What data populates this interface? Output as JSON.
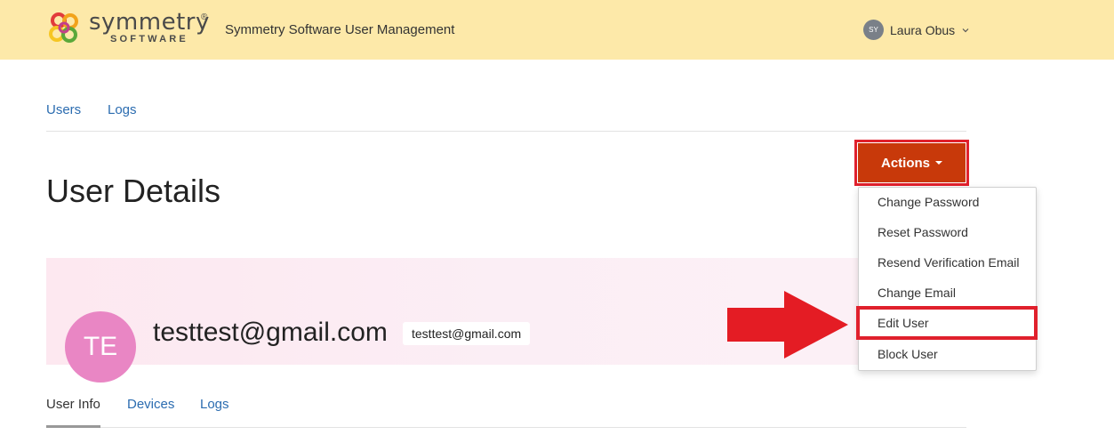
{
  "header": {
    "brand_name": "symmetry",
    "brand_reg": "®",
    "brand_sub": "SOFTWARE",
    "app_title": "Symmetry Software User Management",
    "user_initials": "SY",
    "user_name": "Laura Obus"
  },
  "nav": {
    "users": "Users",
    "logs": "Logs"
  },
  "page_title": "User Details",
  "actions": {
    "label": "Actions",
    "menu": [
      "Change Password",
      "Reset Password",
      "Resend Verification Email",
      "Change Email",
      "Edit User",
      "Block User"
    ],
    "highlighted_item": "Edit User"
  },
  "profile": {
    "initials": "TE",
    "display_name": "testtest@gmail.com",
    "email_chip": "testtest@gmail.com"
  },
  "tabs": {
    "user_info": "User Info",
    "devices": "Devices",
    "logs": "Logs",
    "active": "User Info"
  },
  "colors": {
    "header_bg": "#fde9a9",
    "actions_btn": "#c8390a",
    "highlight_red": "#e0202c",
    "link_blue": "#2b6cb0",
    "avatar_pink": "#e986c4"
  },
  "icons": {
    "logo": "symmetry-logo-icon",
    "user_chevron": "chevron-down-icon",
    "annotation_arrow": "arrow-right-icon"
  }
}
